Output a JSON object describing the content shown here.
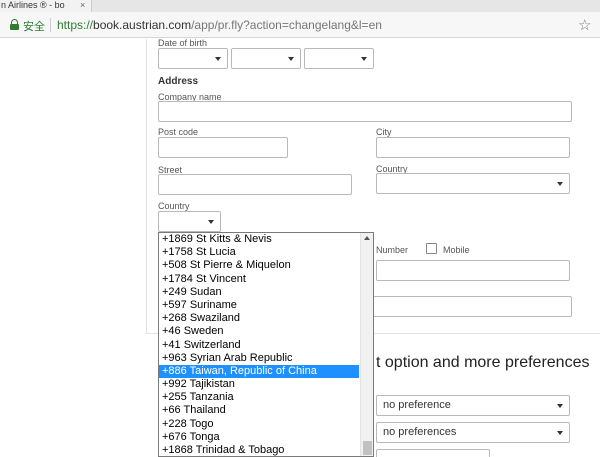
{
  "browser": {
    "tab_title": "n Airlines ® - bo",
    "secure_label": "安全",
    "url_scheme": "https://",
    "url_host": "book.austrian.com",
    "url_path": "/app/pr.fly?action=changelang&l=en"
  },
  "form": {
    "dob_label": "Date of birth",
    "address_heading": "Address",
    "company_label": "Company name",
    "postcode_label": "Post code",
    "city_label": "City",
    "street_label": "Street",
    "country_label_right": "Country",
    "country_label": "Country",
    "number_label": "Number",
    "mobile_label": "Mobile",
    "preferences_heading": "t option and more preferences",
    "pref_select_1": "no preference",
    "pref_select_2": "no preferences"
  },
  "country_code_dropdown": {
    "options": [
      "+1869 St Kitts & Nevis",
      "+1758 St Lucia",
      "+508 St Pierre & Miquelon",
      "+1784 St Vincent",
      "+249 Sudan",
      "+597 Suriname",
      "+268 Swaziland",
      "+46 Sweden",
      "+41 Switzerland",
      "+963 Syrian Arab Republic",
      "+886 Taiwan, Republic of China",
      "+992 Tajikistan",
      "+255 Tanzania",
      "+66 Thailand",
      "+228 Togo",
      "+676 Tonga",
      "+1868 Trinidad & Tobago"
    ],
    "selected_index": 10
  },
  "colors": {
    "selected_bg": "#1e90ff",
    "secure_green": "#2e7d32"
  }
}
